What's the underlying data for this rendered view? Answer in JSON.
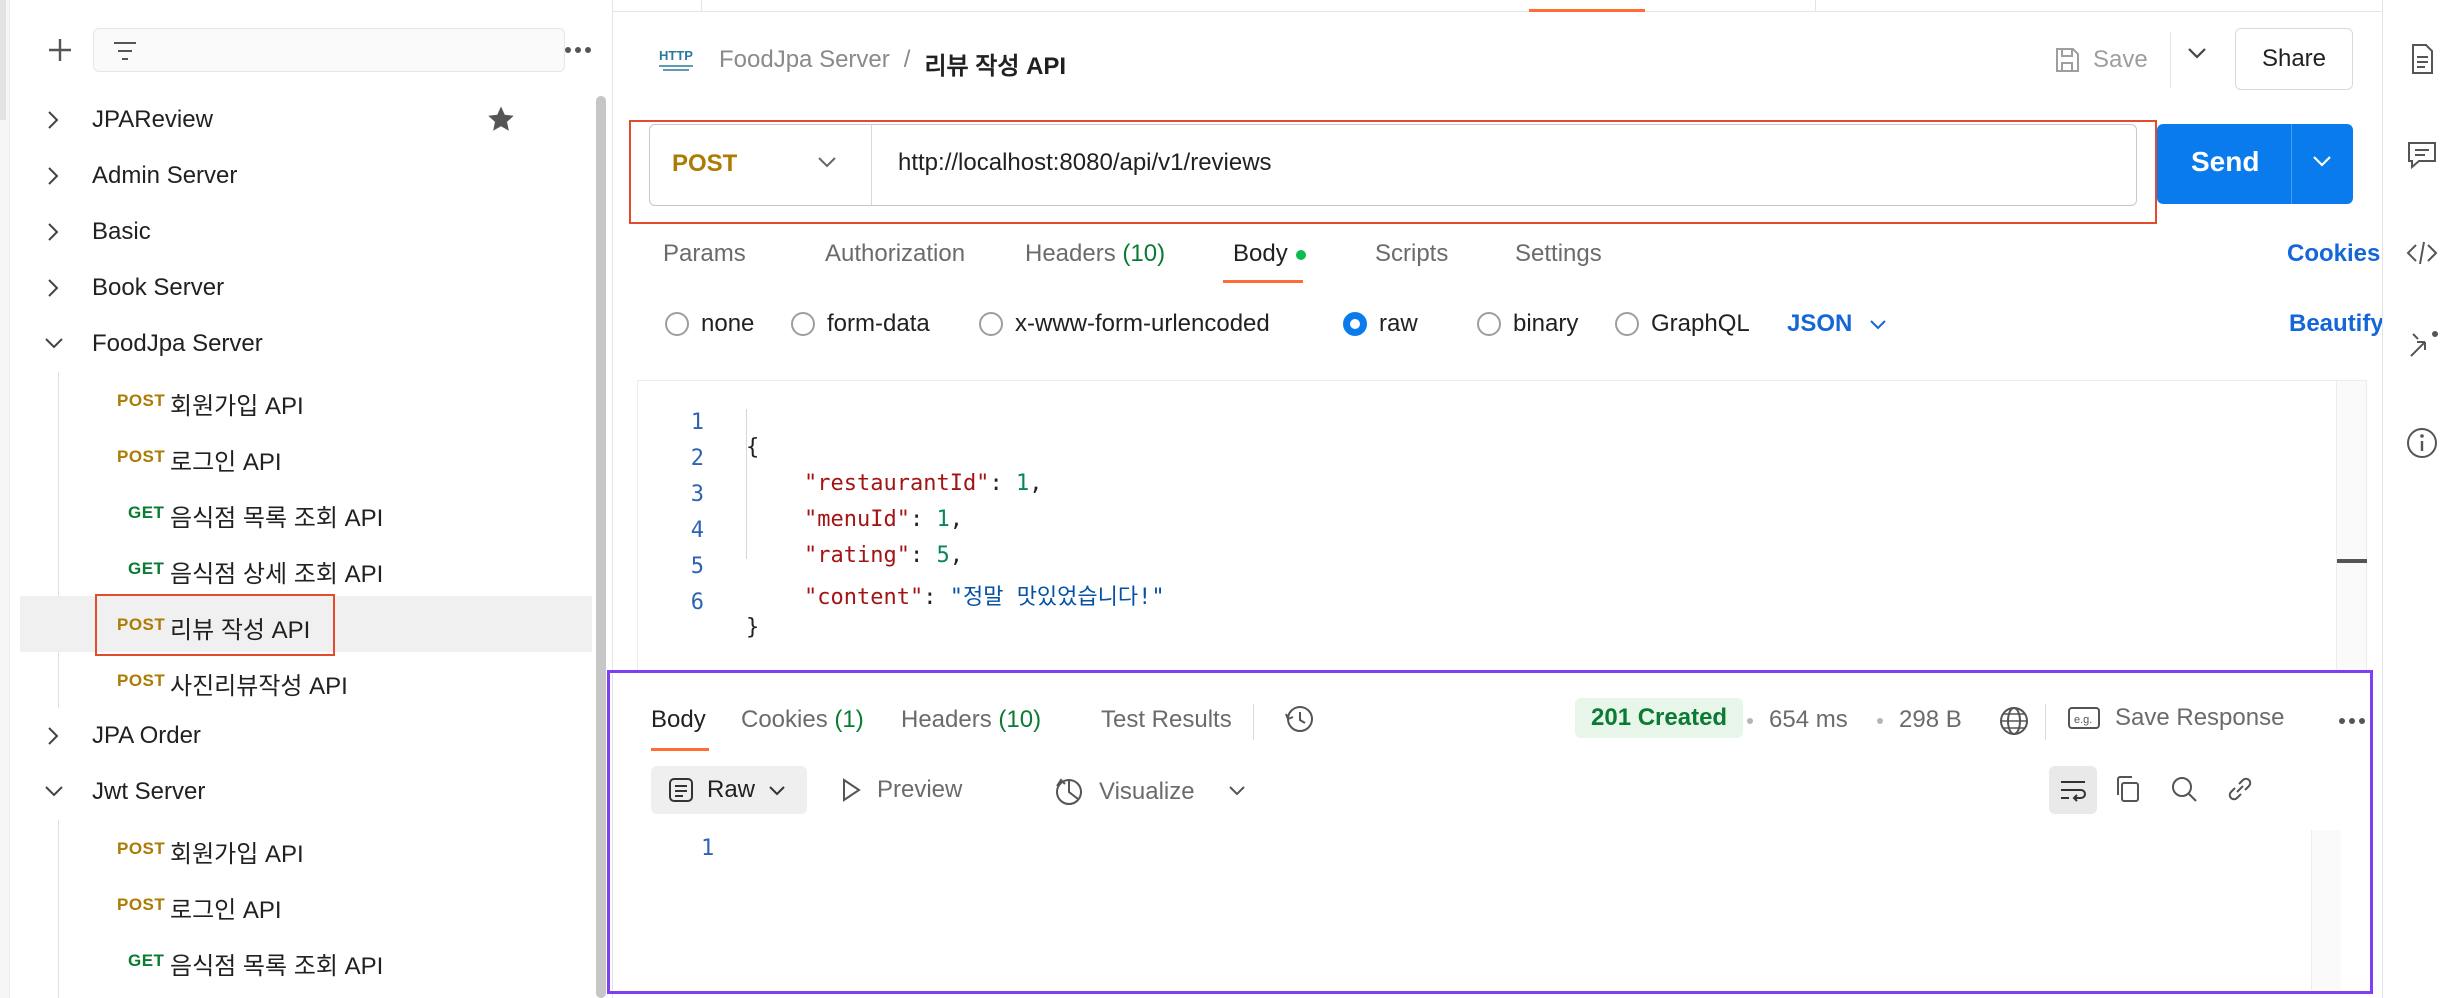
{
  "sidebar": {
    "toolbar": {
      "add_icon": "plus-icon",
      "filter_icon": "filter-icon",
      "more_icon": "more-horizontal-icon"
    },
    "folders": [
      {
        "label": "JPAReview",
        "expanded": false,
        "starred": true
      },
      {
        "label": "Admin Server",
        "expanded": false
      },
      {
        "label": "Basic",
        "expanded": false
      },
      {
        "label": "Book Server",
        "expanded": false
      },
      {
        "label": "FoodJpa Server",
        "expanded": true
      },
      {
        "label": "JPA Order",
        "expanded": false
      },
      {
        "label": "Jwt Server",
        "expanded": true
      }
    ],
    "foodjpa_requests": [
      {
        "method": "POST",
        "name": "회원가입 API"
      },
      {
        "method": "POST",
        "name": "로그인 API"
      },
      {
        "method": "GET",
        "name": "음식점 목록 조회 API"
      },
      {
        "method": "GET",
        "name": "음식점 상세 조회 API"
      },
      {
        "method": "POST",
        "name": "리뷰 작성 API",
        "selected": true
      },
      {
        "method": "POST",
        "name": "사진리뷰작성 API"
      }
    ],
    "jwt_requests": [
      {
        "method": "POST",
        "name": "회원가입 API"
      },
      {
        "method": "POST",
        "name": "로그인 API"
      },
      {
        "method": "GET",
        "name": "음식점 목록 조회 API"
      }
    ]
  },
  "header": {
    "icon": "http-icon",
    "breadcrumb_parent": "FoodJpa Server",
    "breadcrumb_separator": "/",
    "breadcrumb_current": "리뷰 작성 API",
    "save_label": "Save",
    "share_label": "Share"
  },
  "request": {
    "method": "POST",
    "url": "http://localhost:8080/api/v1/reviews",
    "send_label": "Send"
  },
  "request_tabs": {
    "params": "Params",
    "authorization": "Authorization",
    "headers": "Headers",
    "headers_count": "(10)",
    "body": "Body",
    "scripts": "Scripts",
    "settings": "Settings",
    "cookies": "Cookies",
    "active": "Body"
  },
  "body_types": {
    "none": "none",
    "form_data": "form-data",
    "urlencoded": "x-www-form-urlencoded",
    "raw": "raw",
    "binary": "binary",
    "graphql": "GraphQL",
    "selected": "raw",
    "format": "JSON",
    "beautify": "Beautify"
  },
  "editor": {
    "line_numbers": [
      "1",
      "2",
      "3",
      "4",
      "5",
      "6"
    ],
    "lines": [
      {
        "key": "{"
      },
      {
        "key": "\"restaurantId\"",
        "sep": ": ",
        "value": "1",
        "trail": ",",
        "value_type": "number"
      },
      {
        "key": "\"menuId\"",
        "sep": ": ",
        "value": "1",
        "trail": ",",
        "value_type": "number"
      },
      {
        "key": "\"rating\"",
        "sep": ": ",
        "value": "5",
        "trail": ",",
        "value_type": "number"
      },
      {
        "key": "\"content\"",
        "sep": ": ",
        "value": "\"정말 맛있었습니다!\"",
        "trail": "",
        "value_type": "string"
      },
      {
        "key": "}"
      }
    ]
  },
  "response": {
    "tabs": {
      "body": "Body",
      "cookies": "Cookies",
      "cookies_count": "(1)",
      "headers": "Headers",
      "headers_count": "(10)",
      "test_results": "Test Results",
      "active": "Body"
    },
    "status": "201 Created",
    "time": "654 ms",
    "size": "298 B",
    "save_response": "Save Response",
    "view_mode": "Raw",
    "preview": "Preview",
    "visualize": "Visualize",
    "body_line_numbers": [
      "1"
    ]
  },
  "colors": {
    "post": "#ad7a03",
    "get": "#0a7b33",
    "send": "#097bed",
    "accent": "#ff6c37",
    "link": "#1566d6",
    "status_ok": "#0a7b33",
    "highlight_red": "#e34b2f",
    "highlight_purple": "#7e3ff2"
  }
}
